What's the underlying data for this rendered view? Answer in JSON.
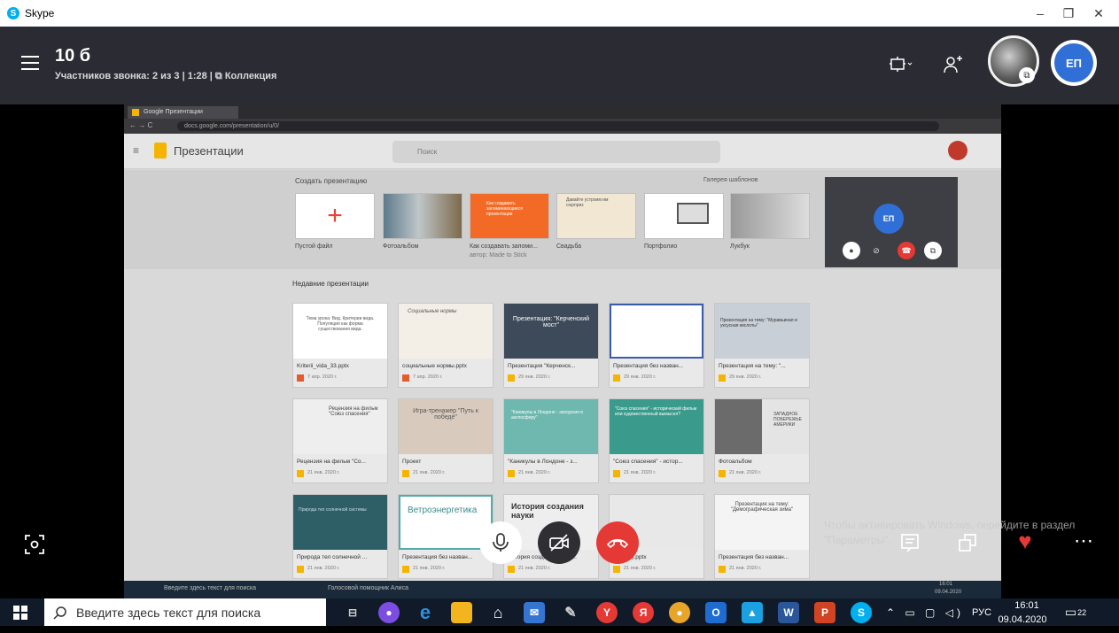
{
  "window": {
    "app_title": "Skype",
    "logo_letter": "S",
    "controls": [
      "–",
      "❐",
      "✕"
    ]
  },
  "call": {
    "title": "10 б",
    "subtitle": "Участников звонка: 2 из 3 | 1:28 | ⧉ Коллекция",
    "avatar_initials": "ЕП"
  },
  "shared_screen": {
    "browser_tab": "Google Презентации",
    "url": "docs.google.com/presentation/u/0/",
    "app_name": "Презентации",
    "search_placeholder": "Поиск",
    "create_heading": "Создать презентацию",
    "gallery_label": "Галерея шаблонов",
    "templates": [
      {
        "label": "Пустой файл"
      },
      {
        "label": "Фотоальбом"
      },
      {
        "label": "Как создавать запоми...",
        "sub": "автор: Made to Stick",
        "thumb_text": "Как создавать запоминающиеся презентации"
      },
      {
        "label": "Свадьба",
        "thumb_text": "Давайте устроим им сюрприз"
      },
      {
        "label": "Портфолио"
      },
      {
        "label": "Лукбук"
      }
    ],
    "recent_heading": "Недавние презентации",
    "recent_row1": [
      {
        "label": "Kriterii_vida_33.pptx",
        "date": "7 апр. 2020 г.",
        "thumb_text": "Тема урока: Вид. Критерии вида. Популяция как форма существования вида."
      },
      {
        "label": "социальные нормы.pptx",
        "date": "7 апр. 2020 г.",
        "thumb_text": "Социальные нормы"
      },
      {
        "label": "Презентация \"Керченск...",
        "date": "29 янв. 2020 г.",
        "thumb_text": "Презентация: \"Керченский мост\""
      },
      {
        "label": "Презентация без назван...",
        "date": "29 янв. 2020 г.",
        "thumb_text": ""
      },
      {
        "label": "Презентация на тему: \"...",
        "date": "29 янв. 2020 г.",
        "thumb_text": "Презентация на тему: \"Муравьиная и уксусная кислоты\""
      }
    ],
    "recent_row2": [
      {
        "label": "Рецензия на фильм \"Со...",
        "date": "21 янв. 2020 г.",
        "thumb_text": "Рецензия на фильм \"Союз спасения\""
      },
      {
        "label": "Проект",
        "date": "21 янв. 2020 г.",
        "thumb_text": "Игра-тренажер \"Путь к победе\""
      },
      {
        "label": "\"Каникулы в Лондоне - з...",
        "date": "21 янв. 2020 г.",
        "thumb_text": "\"Каникулы в Лондоне - экскурсия в англосферу\""
      },
      {
        "label": "\"Союз спасения\" - истор...",
        "date": "21 янв. 2020 г.",
        "thumb_text": "\"Союз спасения\" - исторический фильм или художественный вымысел?"
      },
      {
        "label": "Фотоальбом",
        "date": "21 янв. 2020 г.",
        "thumb_text": "ЗАПАДНОЕ ПОБЕРЕЖЬЕ АМЕРИКИ"
      }
    ],
    "recent_row3": [
      {
        "label": "Природа тел солнечной ...",
        "date": "21 янв. 2020 г.",
        "thumb_text": "Природа тел солнечной системы"
      },
      {
        "label": "Презентация без назван...",
        "date": "21 янв. 2020 г.",
        "thumb_text": "Ветроэнергетика"
      },
      {
        "label": "История создания науку...",
        "date": "21 янв. 2020 г.",
        "thumb_text": "История создания науки"
      },
      {
        "label": "work (1).pptx",
        "date": "21 янв. 2020 г.",
        "thumb_text": ""
      },
      {
        "label": "Презентация без назван...",
        "date": "21 янв. 2020 г.",
        "thumb_text": "Презентация на тему: \"Демографическая зима\""
      }
    ],
    "inner_search_placeholder": "Введите здесь текст для поиска",
    "inner_voice_assistant": "Голосовой помощник Алиса",
    "inner_clock": "16:01",
    "inner_date": "09.04.2020"
  },
  "self_view": {
    "initials": "ЕП"
  },
  "activation_watermark": "Чтобы активировать Windows, перейдите в раздел \"Параметры\".",
  "taskbar": {
    "search_placeholder": "Введите здесь текст для поиска",
    "language": "РУС",
    "time": "16:01",
    "date": "09.04.2020",
    "notification_count": "22"
  },
  "colors": {
    "skype_blue": "#00aff0",
    "hangup_red": "#e53935",
    "avatar_blue": "#2f6fd6",
    "call_bg": "#2b2c33"
  }
}
